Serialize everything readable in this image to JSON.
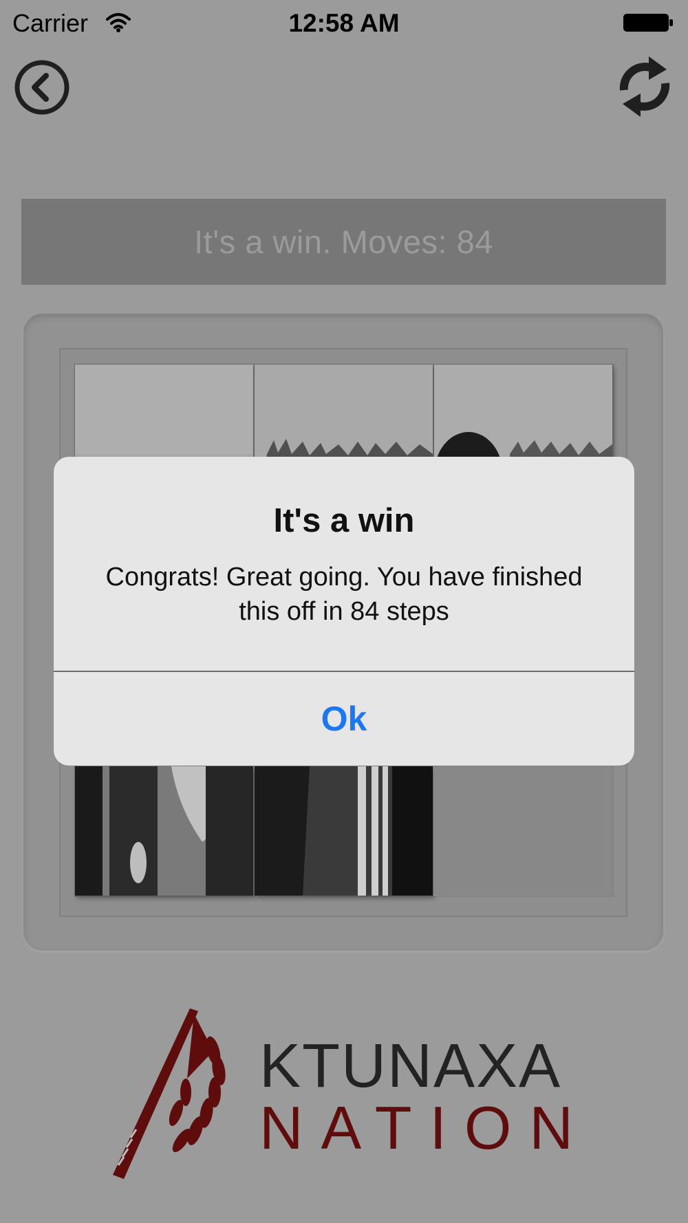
{
  "status_bar": {
    "carrier": "Carrier",
    "time": "12:58 AM",
    "wifi_icon": "wifi-icon",
    "battery_icon": "battery-icon"
  },
  "navigation": {
    "back_icon": "chevron-left-circle-icon",
    "refresh_icon": "refresh-icon"
  },
  "game": {
    "status_text": "It's a win. Moves: 84"
  },
  "alert": {
    "title": "It's a win",
    "message": "Congrats! Great going. You have finished this off in 84 steps",
    "button_label": "Ok"
  },
  "branding": {
    "line1": "KTUNAXA",
    "line2": "NATION"
  },
  "colors": {
    "background": "#9b9b9b",
    "banner": "#777777",
    "alert_background": "#e6e6e6",
    "alert_button": "#1b78f2",
    "logo_red": "#5e0c0c",
    "logo_dark": "#232323"
  }
}
